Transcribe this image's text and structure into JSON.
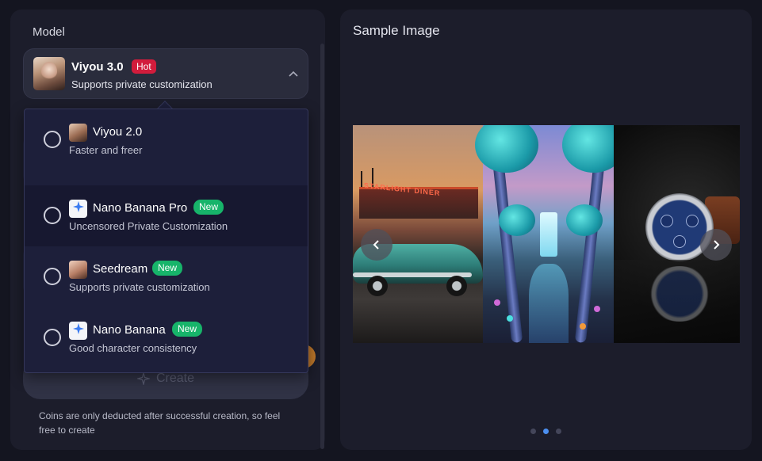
{
  "left_panel": {
    "model_label": "Model",
    "selected_model": {
      "name": "Viyou 3.0",
      "badge": "Hot",
      "subtitle": "Supports private customization"
    },
    "create_label": "Create",
    "coins_note": "Coins are only deducted after successful creation, so feel free to create"
  },
  "dropdown": {
    "options": [
      {
        "name": "Viyou 2.0",
        "subtitle": "Faster and freer",
        "icon": "viyou-thumbnail-icon",
        "badge": ""
      },
      {
        "name": "Nano Banana Pro",
        "subtitle": "Uncensored Private Customization",
        "icon": "banana-logo-icon",
        "badge": "New"
      },
      {
        "name": "Seedream",
        "subtitle": "Supports private customization",
        "icon": "seedream-thumbnail-icon",
        "badge": "New"
      },
      {
        "name": "Nano Banana",
        "subtitle": "Good character consistency",
        "icon": "banana-logo-icon",
        "badge": "New"
      }
    ]
  },
  "right_panel": {
    "title": "Sample Image",
    "carousel": {
      "slides": [
        "vintage-car-diner",
        "fantasy-forest-waterfall",
        "luxury-watch"
      ],
      "active_dot": 1,
      "dot_count": 3
    }
  },
  "colors": {
    "background": "#141520",
    "panel": "#1c1d2b",
    "hot_badge": "#d21c3c",
    "new_badge": "#17b46a",
    "active_dot": "#4c8ff0"
  }
}
